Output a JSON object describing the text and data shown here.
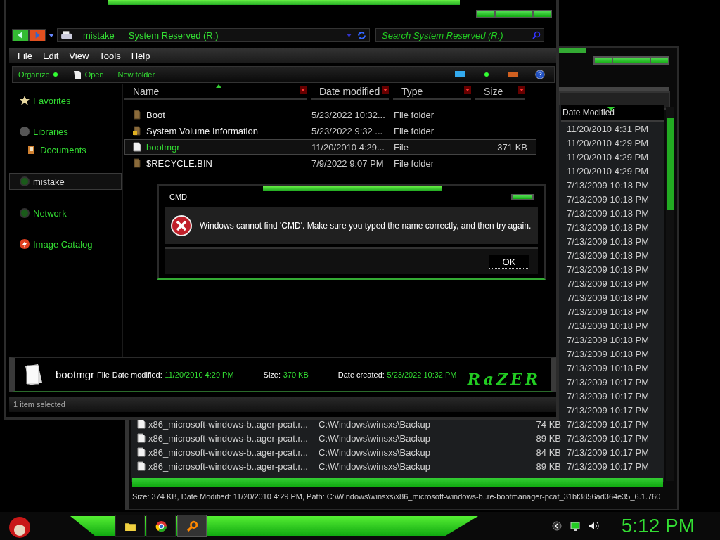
{
  "back_window": {
    "column": {
      "label": "Date Modified",
      "sorted": true
    },
    "rows": [
      {
        "date": "11/20/2010 4:31 PM"
      },
      {
        "date": "11/20/2010 4:29 PM"
      },
      {
        "date": "11/20/2010 4:29 PM"
      },
      {
        "date": "11/20/2010 4:29 PM"
      },
      {
        "date": "7/13/2009 10:18 PM"
      },
      {
        "date": "7/13/2009 10:18 PM"
      },
      {
        "date": "7/13/2009 10:18 PM"
      },
      {
        "date": "7/13/2009 10:18 PM"
      },
      {
        "date": "7/13/2009 10:18 PM"
      },
      {
        "date": "7/13/2009 10:18 PM"
      },
      {
        "date": "7/13/2009 10:18 PM"
      },
      {
        "date": "7/13/2009 10:18 PM"
      },
      {
        "date": "7/13/2009 10:18 PM"
      },
      {
        "date": "7/13/2009 10:18 PM"
      },
      {
        "date": "7/13/2009 10:18 PM"
      },
      {
        "date": "7/13/2009 10:18 PM"
      },
      {
        "date": "7/13/2009 10:18 PM"
      },
      {
        "date": "7/13/2009 10:18 PM"
      },
      {
        "date": "7/13/2009 10:17 PM"
      },
      {
        "date": "7/13/2009 10:17 PM"
      },
      {
        "date": "7/13/2009 10:17 PM"
      },
      {
        "name": "x86_microsoft-windows-b..ager-pcat.r...",
        "path": "C:\\Windows\\winsxs\\Backup",
        "size": "74 KB",
        "date": "7/13/2009 10:17 PM"
      },
      {
        "name": "x86_microsoft-windows-b..ager-pcat.r...",
        "path": "C:\\Windows\\winsxs\\Backup",
        "size": "89 KB",
        "date": "7/13/2009 10:17 PM"
      },
      {
        "name": "x86_microsoft-windows-b..ager-pcat.r...",
        "path": "C:\\Windows\\winsxs\\Backup",
        "size": "84 KB",
        "date": "7/13/2009 10:17 PM"
      },
      {
        "name": "x86_microsoft-windows-b..ager-pcat.r...",
        "path": "C:\\Windows\\winsxs\\Backup",
        "size": "89 KB",
        "date": "7/13/2009 10:17 PM"
      }
    ],
    "status": "Size: 374 KB, Date Modified: 11/20/2010 4:29 PM, Path: C:\\Windows\\winsxs\\x86_microsoft-windows-b..re-bootmanager-pcat_31bf3856ad364e35_6.1.760"
  },
  "front_window": {
    "breadcrumbs": [
      "mistake",
      "System Reserved (R:)"
    ],
    "search": {
      "placeholder": "Search System Reserved (R:)"
    },
    "menu": [
      "File",
      "Edit",
      "View",
      "Tools",
      "Help"
    ],
    "toolbar": [
      {
        "label": "Organize",
        "kind": "menu"
      },
      {
        "label": "Open",
        "kind": "open"
      },
      {
        "label": "New folder",
        "kind": "plain"
      }
    ],
    "nav_pane": [
      {
        "label": "Favorites",
        "kind": "favorites",
        "selected": false
      },
      {
        "label": "Libraries",
        "kind": "libraries",
        "selected": false,
        "children": [
          {
            "label": "Documents",
            "kind": "documents",
            "selected": false
          }
        ]
      },
      {
        "label": "mistake",
        "kind": "computer",
        "selected": true
      },
      {
        "label": "Network",
        "kind": "network",
        "selected": false
      },
      {
        "label": "Image Catalog",
        "kind": "catalog",
        "selected": false
      }
    ],
    "columns": [
      {
        "label": "Name",
        "sorted": true
      },
      {
        "label": "Date modified",
        "sorted": false
      },
      {
        "label": "Type",
        "sorted": false
      },
      {
        "label": "Size",
        "sorted": false
      }
    ],
    "files": [
      {
        "name": "Boot",
        "date": "5/23/2022 10:32...",
        "type": "File folder",
        "kind": "folder",
        "selected": false
      },
      {
        "name": "System Volume Information",
        "date": "5/23/2022 9:32 ...",
        "type": "File folder",
        "kind": "locked_folder",
        "selected": false
      },
      {
        "name": "bootmgr",
        "date": "11/20/2010 4:29...",
        "type": "File",
        "size": "371 KB",
        "kind": "file",
        "selected": true
      },
      {
        "name": "$RECYCLE.BIN",
        "date": "7/9/2022 9:07 PM",
        "type": "File folder",
        "kind": "folder",
        "selected": false
      }
    ],
    "details": {
      "name": "bootmgr",
      "type": "File",
      "fields": [
        {
          "label": "Date modified:",
          "value": "11/20/2010 4:29 PM"
        },
        {
          "label": "Size:",
          "value": "370 KB"
        },
        {
          "label": "Date created:",
          "value": "5/23/2022 10:32 PM"
        }
      ],
      "logo": "RaZER"
    },
    "status": "1 item selected"
  },
  "dialog": {
    "title": "CMD",
    "message": "Windows cannot find 'CMD'. Make sure you typed the name correctly, and then try again.",
    "button": "OK"
  },
  "taskbar": {
    "apps": [
      {
        "kind": "folder",
        "selected": false
      },
      {
        "kind": "browser",
        "selected": false
      },
      {
        "kind": "search",
        "selected": true
      }
    ],
    "clock": "5:12 PM"
  }
}
